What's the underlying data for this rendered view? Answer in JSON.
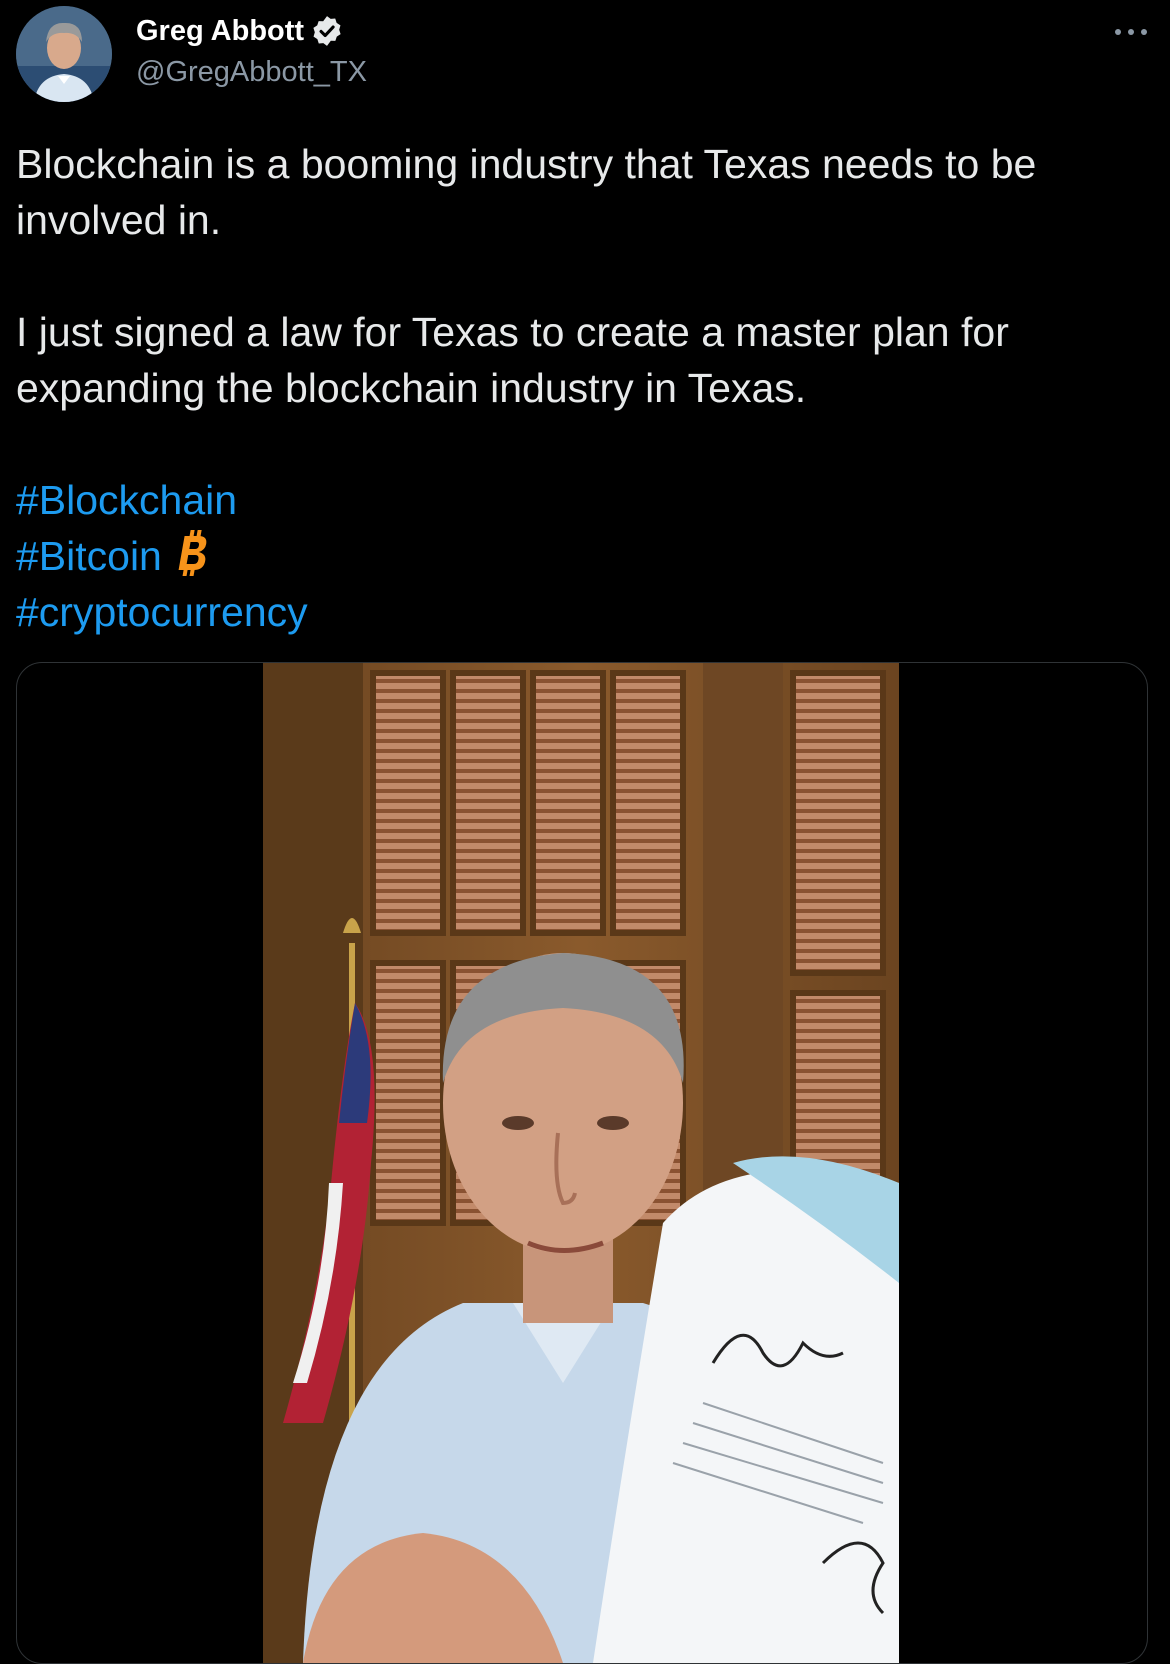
{
  "author": {
    "name": "Greg Abbott",
    "handle": "@GregAbbott_TX",
    "avatar_icon": "profile-photo",
    "verified_icon": "verified-badge-icon"
  },
  "tweet": {
    "paragraph_1": "Blockchain is a booming industry that Texas needs to be involved in.",
    "paragraph_2": "I just signed a law for Texas to create a master plan for expanding the blockchain industry in Texas.",
    "hashtags": [
      "#Blockchain",
      "#Bitcoin",
      "#cryptocurrency"
    ],
    "bitcoin_emoji_icon": "bitcoin-icon"
  },
  "media": {
    "type": "video",
    "description_icon": "video-thumbnail"
  },
  "colors": {
    "background": "#000000",
    "text": "#e7e9ea",
    "secondary_text": "#8b98a5",
    "link": "#1d9bf0",
    "bitcoin": "#f7931a",
    "border": "#2f3336"
  }
}
